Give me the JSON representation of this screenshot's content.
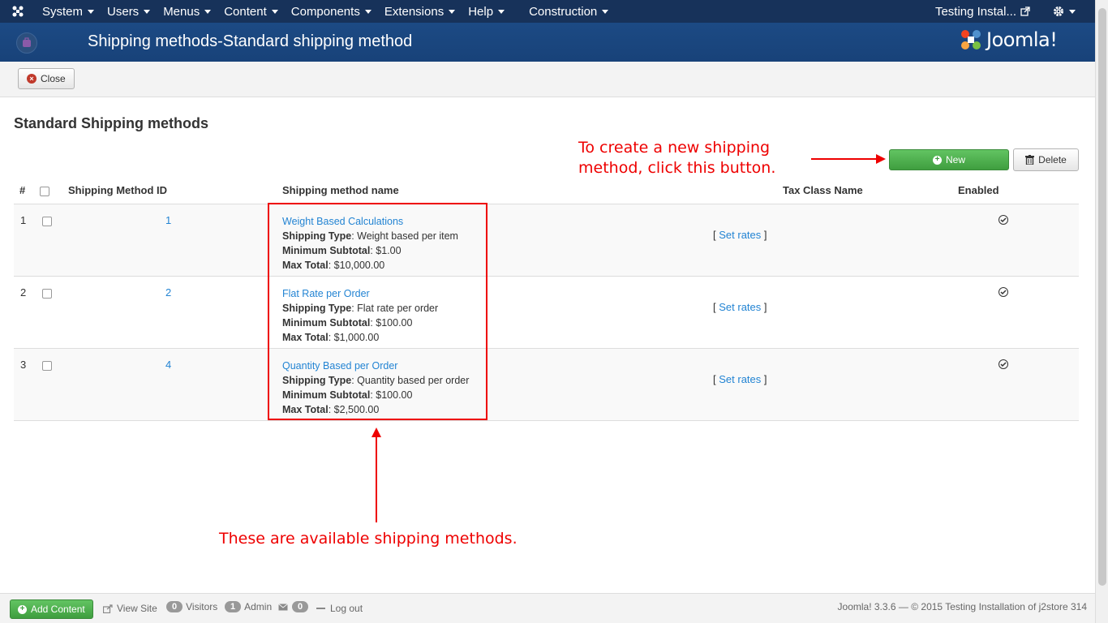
{
  "navbar": {
    "menu": [
      {
        "label": "System"
      },
      {
        "label": "Users"
      },
      {
        "label": "Menus"
      },
      {
        "label": "Content"
      },
      {
        "label": "Components"
      },
      {
        "label": "Extensions"
      },
      {
        "label": "Help"
      },
      {
        "label": "Construction"
      }
    ],
    "site_name": "Testing Instal...",
    "colors": {
      "bar": "#17325a"
    }
  },
  "header": {
    "title": "Shipping methods-Standard shipping method",
    "logo_text": "Joomla!"
  },
  "toolbar": {
    "close_label": "Close"
  },
  "main": {
    "heading": "Standard Shipping methods",
    "new_label": "New",
    "delete_label": "Delete",
    "columns": [
      "#",
      "Shipping Method ID",
      "Shipping method name",
      "Tax Class Name",
      "Enabled"
    ],
    "rows": [
      {
        "num": "1",
        "id": "1",
        "name": "Weight Based Calculations",
        "type_label": "Shipping Type",
        "type_value": ": Weight based per item",
        "min_label": "Minimum Subtotal",
        "min_value": ": $1.00",
        "max_label": "Max Total",
        "max_value": ": $10,000.00",
        "set_rates": "Set rates",
        "enabled": true
      },
      {
        "num": "2",
        "id": "2",
        "name": "Flat Rate per Order",
        "type_label": "Shipping Type",
        "type_value": ": Flat rate per order",
        "min_label": "Minimum Subtotal",
        "min_value": ": $100.00",
        "max_label": "Max Total",
        "max_value": ": $1,000.00",
        "set_rates": "Set rates",
        "enabled": true
      },
      {
        "num": "3",
        "id": "4",
        "name": "Quantity Based per Order",
        "type_label": "Shipping Type",
        "type_value": ": Quantity based per order",
        "min_label": "Minimum Subtotal",
        "min_value": ": $100.00",
        "max_label": "Max Total",
        "max_value": ": $2,500.00",
        "set_rates": "Set rates",
        "enabled": true
      }
    ]
  },
  "annotations": {
    "new_button_line1": "To create a new shipping",
    "new_button_line2": "method, click this button.",
    "methods": "These are available shipping methods.",
    "color": "#e00000"
  },
  "footer": {
    "add_content": "Add Content",
    "view_site": "View Site",
    "visitors_count": "0",
    "visitors_label": "Visitors",
    "admin_count": "1",
    "admin_label": "Admin",
    "messages_count": "0",
    "logout": "Log out",
    "copyright": "Joomla! 3.3.6  —  © 2015 Testing Installation of j2store 314"
  }
}
